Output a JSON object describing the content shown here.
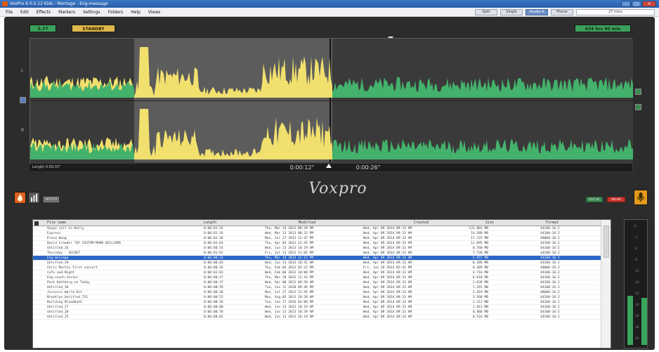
{
  "window": {
    "title": "VoxPro 6.0.0.12   Kids : Montage : Eng-message",
    "buttons": [
      "–",
      "□",
      "×"
    ]
  },
  "menu": {
    "items": [
      "File",
      "Edit",
      "Effects",
      "Markers",
      "Settings",
      "Folders",
      "Help",
      "Views"
    ],
    "modes": [
      "Split",
      "Single",
      "Studio A",
      "Phone"
    ],
    "active_mode": "Studio A",
    "memory": "27 mins"
  },
  "status": {
    "counter": "5.77",
    "state": "STANDBY",
    "remaining": "634 hrs 00 min"
  },
  "waveform": {
    "channels": [
      "L",
      "R"
    ],
    "length_label": "Length 0:00:33\"",
    "time_left": "0:00:12\"",
    "time_right": "0:00:26\"",
    "colors": {
      "selection": "#f2e06e",
      "audio": "#44b26c",
      "cursor": "#ffffff"
    }
  },
  "controls": {
    "logo": "Voxpro",
    "mini_button": "MASTER",
    "right_buttons": [
      "EDIT BC",
      "ON AIR"
    ],
    "icons": [
      "fire-icon",
      "meters-icon",
      "mic-icon"
    ]
  },
  "browser": {
    "columns": [
      "File name",
      "Length",
      "Modified",
      "Created",
      "Size",
      "Format"
    ],
    "rows": [
      {
        "name": "Skype call to Kelly",
        "length": "0:00:01:16",
        "modified": "Thu, Mar 14 2013   08:39 PM",
        "created": "Wed, Apr 09 2014   09:33 AM",
        "size": "131.801 MB",
        "format": "44100-16-2"
      },
      {
        "name": "Express",
        "length": "0:00:01:24",
        "modified": "Wed, Mar 13 2013   08:32 PM",
        "created": "Wed, Apr 09 2014   09:33 AM",
        "size": "14.588 MB",
        "format": "44100-16-2"
      },
      {
        "name": "Elesa Wong",
        "length": "0:00:02:36",
        "modified": "Mon, Jul 27 2013   12:47 PM",
        "created": "Wed, Apr 09 2014   09:33 AM",
        "size": "17.225 MB",
        "format": "48000-16-2"
      },
      {
        "name": "David Crowder TOY CUSTOM-MARK WILLIAMS",
        "length": "0:00:01:03",
        "modified": "Thu, Apr 04 2013   12:45 PM",
        "created": "Wed, Apr 09 2014   09:33 AM",
        "size": "11.095 MB",
        "format": "44100-16-2"
      },
      {
        "name": "Untitled_26",
        "length": "0:00:00:54",
        "modified": "Wed, Jun 13 2013   10:19 AM",
        "created": "Wed, Apr 09 2014   09:33 AM",
        "size": "8.760 MB",
        "format": "44100-16-2"
      },
      {
        "name": "Thursday - SECRET",
        "length": "0:00:01:01",
        "modified": "Fri, Jul 13 2013   11:05 PM",
        "created": "Wed, Apr 09 2014   09:33 AM",
        "size": "7.720 MB",
        "format": "44100-16-2"
      },
      {
        "name": "Eng-message",
        "length": "0:00:00:33",
        "modified": "Thu, Mar 14 2013   12:13 PM",
        "created": "Wed, Apr 09 2014   09:33 AM",
        "size": "5.972 MB",
        "format": "44100-16-2"
      },
      {
        "name": "Untitled_29",
        "length": "0:00:00:03",
        "modified": "Wed, Jun 13 2013   10:41 AM",
        "created": "Wed, Apr 09 2014   09:33 AM",
        "size": "8.209 MB",
        "format": "44100-16-2"
      },
      {
        "name": "Chris Martin first concert",
        "length": "0:00:00:26",
        "modified": "Thu, Feb 04 2013   03:32 PM",
        "created": "Fri, Jun 20 2014   02:41 PM",
        "size": "8.409 MB",
        "format": "48000-16-2"
      },
      {
        "name": "Cafe and Night",
        "length": "0:00:01:03",
        "modified": "Wed, Feb 06 2013   10:08 PM",
        "created": "Wed, Apr 09 2014   09:33 AM",
        "size": "4.716 MB",
        "format": "44100-16-2"
      },
      {
        "name": "Eng-couch-Jester",
        "length": "0:00:00:47",
        "modified": "Thu, Mar 28 2013   12:43 PM",
        "created": "Wed, Apr 09 2014   09:33 AM",
        "size": "6.618 MB",
        "format": "44100-16-2"
      },
      {
        "name": "Park Kahlberg on Today",
        "length": "0:00:00:37",
        "modified": "Wed, Apr 08 2013   09:58 AM",
        "created": "Wed, Apr 09 2014   09:33 AM",
        "size": "1.628 MB",
        "format": "44100-16-2"
      },
      {
        "name": "Untitled_30",
        "length": "0:00:00:59",
        "modified": "Tue, Jun 12 2018   09:46 PM",
        "created": "Wed, Apr 09 2014   09:33 AM",
        "size": "1.291 MB",
        "format": "44100-16-2"
      },
      {
        "name": "Jurassic World Hit",
        "length": "0:00:00:28",
        "modified": "Mon, Jul 27 2013   12:45 PM",
        "created": "Wed, Apr 09 2014   09:33 AM",
        "size": "2.919 MB",
        "format": "48000-16-2"
      },
      {
        "name": "Brooklyn_Untitled_731",
        "length": "0:00:00:52",
        "modified": "Mon, Aug 03 2013   10:38 AM",
        "created": "Wed, Apr 09 2014   09:33 AM",
        "size": "3.568 MB",
        "format": "44100-16-2"
      },
      {
        "name": "Building Bloodbath",
        "length": "0:00:00:36",
        "modified": "Tue, Jan 17 2016   03:08 PM",
        "created": "Wed, Apr 09 2014   09:33 AM",
        "size": "1.311 MB",
        "format": "44100-16-2"
      },
      {
        "name": "Untitled_27",
        "length": "0:00:00:00",
        "modified": "Wed, Jun 13 2013   10:19 AM",
        "created": "Wed, Apr 09 2014   09:33 AM",
        "size": "1.013 MB",
        "format": "44100-16-2"
      },
      {
        "name": "Untitled_28",
        "length": "0:00:00:78",
        "modified": "Wed, Jun 13 2013   10:39 AM",
        "created": "Wed, Apr 09 2014   09:33 AM",
        "size": "0.868 MB",
        "format": "44100-16-2"
      },
      {
        "name": "Untitled_25",
        "length": "0:00:00:03",
        "modified": "Wed, Jun 13 2013   10:19 AM",
        "created": "Wed, Apr 09 2014   09:33 AM",
        "size": "0.516 MB",
        "format": "44100-16-2"
      }
    ],
    "selected_index": 6
  },
  "meter": {
    "levels": [
      0.4,
      0.38
    ],
    "scale": [
      "0",
      "-3",
      "-6",
      "-9",
      "-12",
      "-18",
      "-24",
      "-30",
      "-36",
      "-48",
      "-60"
    ]
  }
}
